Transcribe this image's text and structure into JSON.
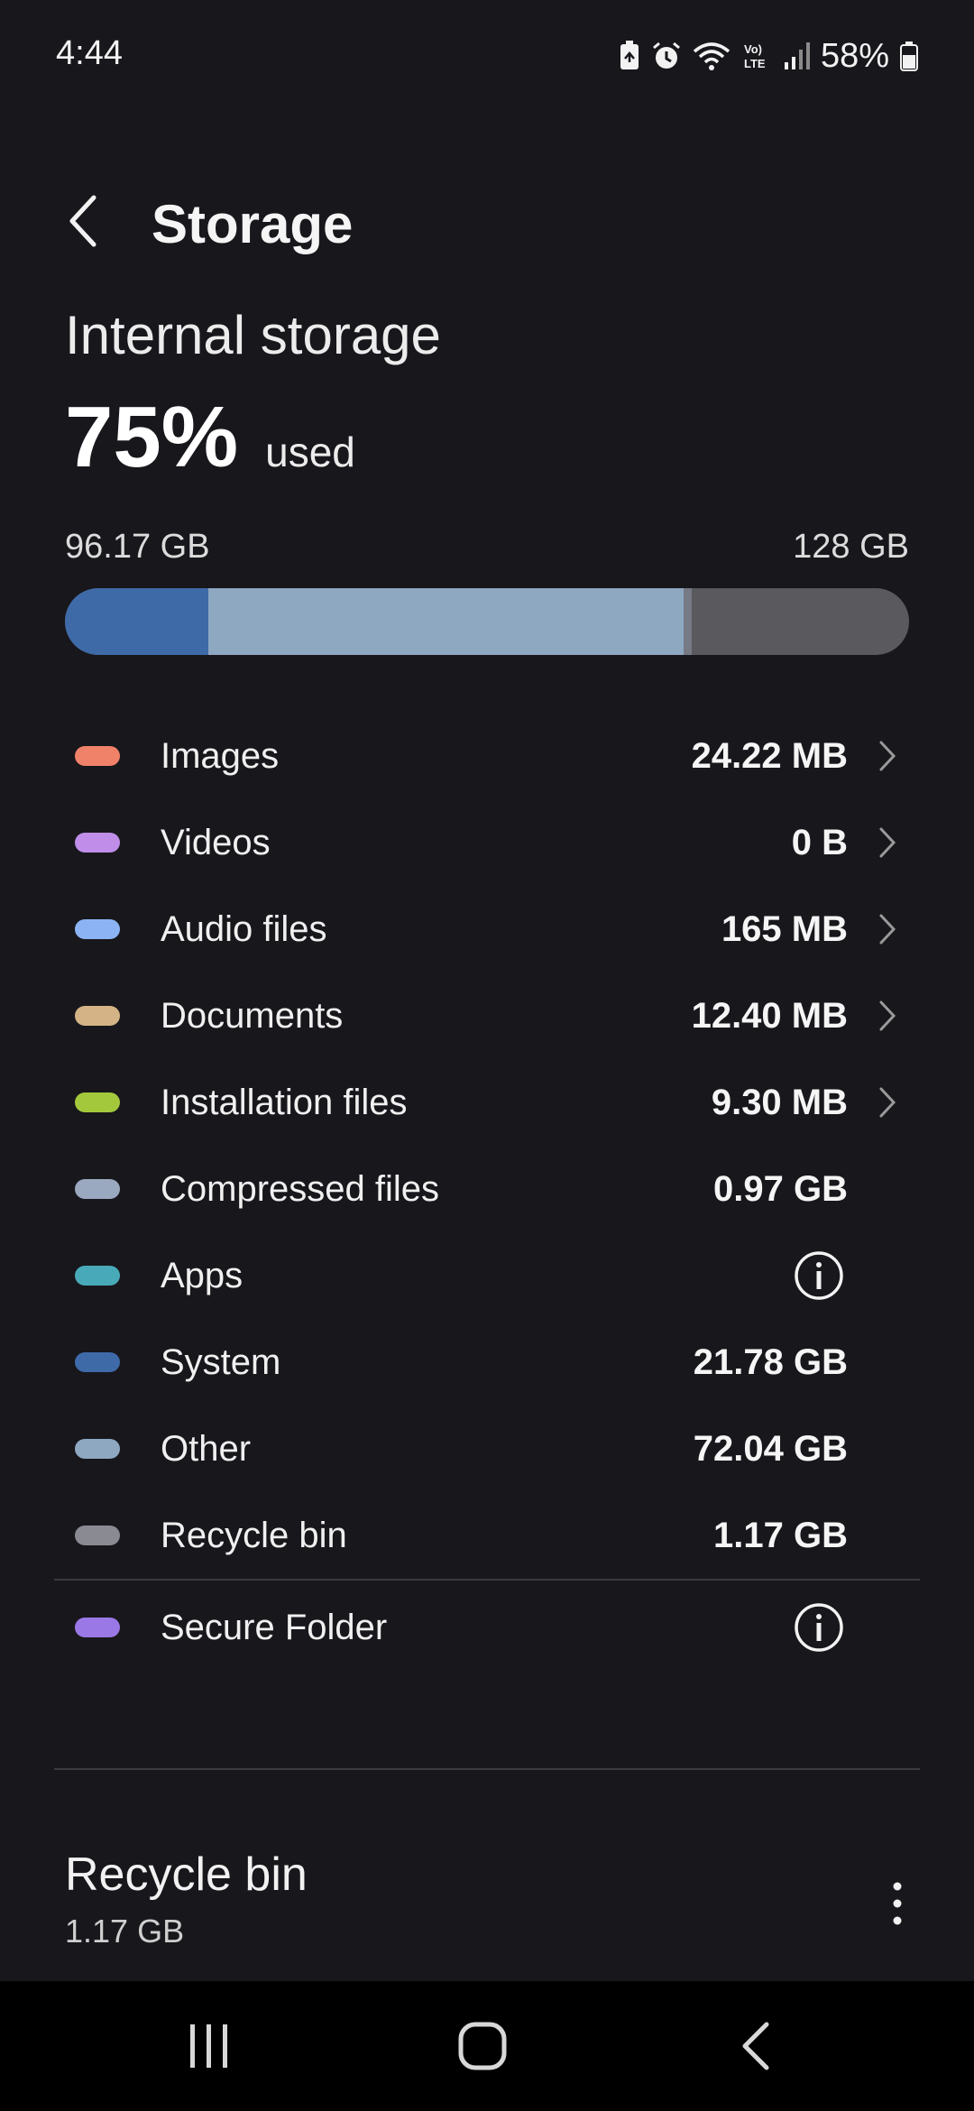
{
  "status_bar": {
    "time": "4:44",
    "battery": "58%",
    "icons": [
      "battery-saver-icon",
      "alarm-icon",
      "wifi-icon",
      "volte-icon",
      "signal-icon",
      "battery-icon"
    ]
  },
  "header": {
    "title": "Storage",
    "back_icon": "back-chevron-icon"
  },
  "storage": {
    "heading": "Internal storage",
    "percent": "75%",
    "percent_label": "used",
    "used": "96.17 GB",
    "total": "128 GB",
    "used_fraction": 0.75,
    "segments": [
      {
        "name": "System",
        "value_gb": 21.78,
        "color": "#3e6aa8"
      },
      {
        "name": "Other",
        "value_gb": 72.04,
        "color": "#8ea8c2"
      },
      {
        "name": "Recycle bin",
        "value_gb": 1.17,
        "color": "#767a85"
      }
    ],
    "total_gb": 128
  },
  "categories": [
    {
      "name": "Images",
      "value": "24.22 MB",
      "color": "#f0826a",
      "chevron": true
    },
    {
      "name": "Videos",
      "value": "0 B",
      "color": "#c08ee8",
      "chevron": true
    },
    {
      "name": "Audio files",
      "value": "165 MB",
      "color": "#8cb4f4",
      "chevron": true
    },
    {
      "name": "Documents",
      "value": "12.40 MB",
      "color": "#d4b486",
      "chevron": true
    },
    {
      "name": "Installation files",
      "value": "9.30 MB",
      "color": "#a4c83c",
      "chevron": true
    },
    {
      "name": "Compressed files",
      "value": "0.97 GB",
      "color": "#9aa8c0",
      "chevron": false
    },
    {
      "name": "Apps",
      "value": "",
      "color": "#48aab8",
      "info": true
    },
    {
      "name": "System",
      "value": "21.78 GB",
      "color": "#3e6aa8",
      "chevron": false
    },
    {
      "name": "Other",
      "value": "72.04 GB",
      "color": "#8ea8c2",
      "chevron": false
    },
    {
      "name": "Recycle bin",
      "value": "1.17 GB",
      "color": "#8a8a92",
      "chevron": false
    }
  ],
  "secure_folder": {
    "name": "Secure Folder",
    "color": "#9a78e6",
    "info": true
  },
  "recycle_card": {
    "title": "Recycle bin",
    "size": "1.17 GB"
  },
  "nav_bar": {
    "recents_icon": "recents-icon",
    "home_icon": "home-icon",
    "back_icon": "nav-back-icon"
  }
}
